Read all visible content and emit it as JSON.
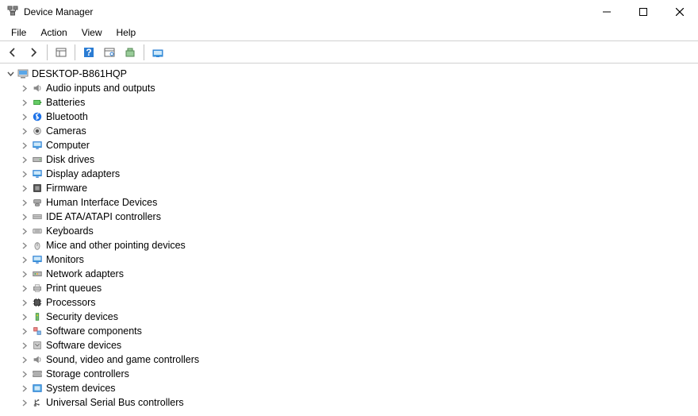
{
  "window": {
    "title": "Device Manager"
  },
  "menu": {
    "file": "File",
    "action": "Action",
    "view": "View",
    "help": "Help"
  },
  "root": {
    "name": "DESKTOP-B861HQP",
    "expanded": true
  },
  "categories": [
    {
      "id": "audio",
      "label": "Audio inputs and outputs"
    },
    {
      "id": "batteries",
      "label": "Batteries"
    },
    {
      "id": "bluetooth",
      "label": "Bluetooth"
    },
    {
      "id": "cameras",
      "label": "Cameras"
    },
    {
      "id": "computer",
      "label": "Computer"
    },
    {
      "id": "disk",
      "label": "Disk drives"
    },
    {
      "id": "display",
      "label": "Display adapters"
    },
    {
      "id": "firmware",
      "label": "Firmware"
    },
    {
      "id": "hid",
      "label": "Human Interface Devices"
    },
    {
      "id": "ide",
      "label": "IDE ATA/ATAPI controllers"
    },
    {
      "id": "keyboards",
      "label": "Keyboards"
    },
    {
      "id": "mice",
      "label": "Mice and other pointing devices"
    },
    {
      "id": "monitors",
      "label": "Monitors"
    },
    {
      "id": "network",
      "label": "Network adapters"
    },
    {
      "id": "print",
      "label": "Print queues"
    },
    {
      "id": "processors",
      "label": "Processors"
    },
    {
      "id": "security",
      "label": "Security devices"
    },
    {
      "id": "swcomp",
      "label": "Software components"
    },
    {
      "id": "swdev",
      "label": "Software devices"
    },
    {
      "id": "sound",
      "label": "Sound, video and game controllers"
    },
    {
      "id": "storage",
      "label": "Storage controllers"
    },
    {
      "id": "system",
      "label": "System devices"
    },
    {
      "id": "usb",
      "label": "Universal Serial Bus controllers"
    }
  ]
}
